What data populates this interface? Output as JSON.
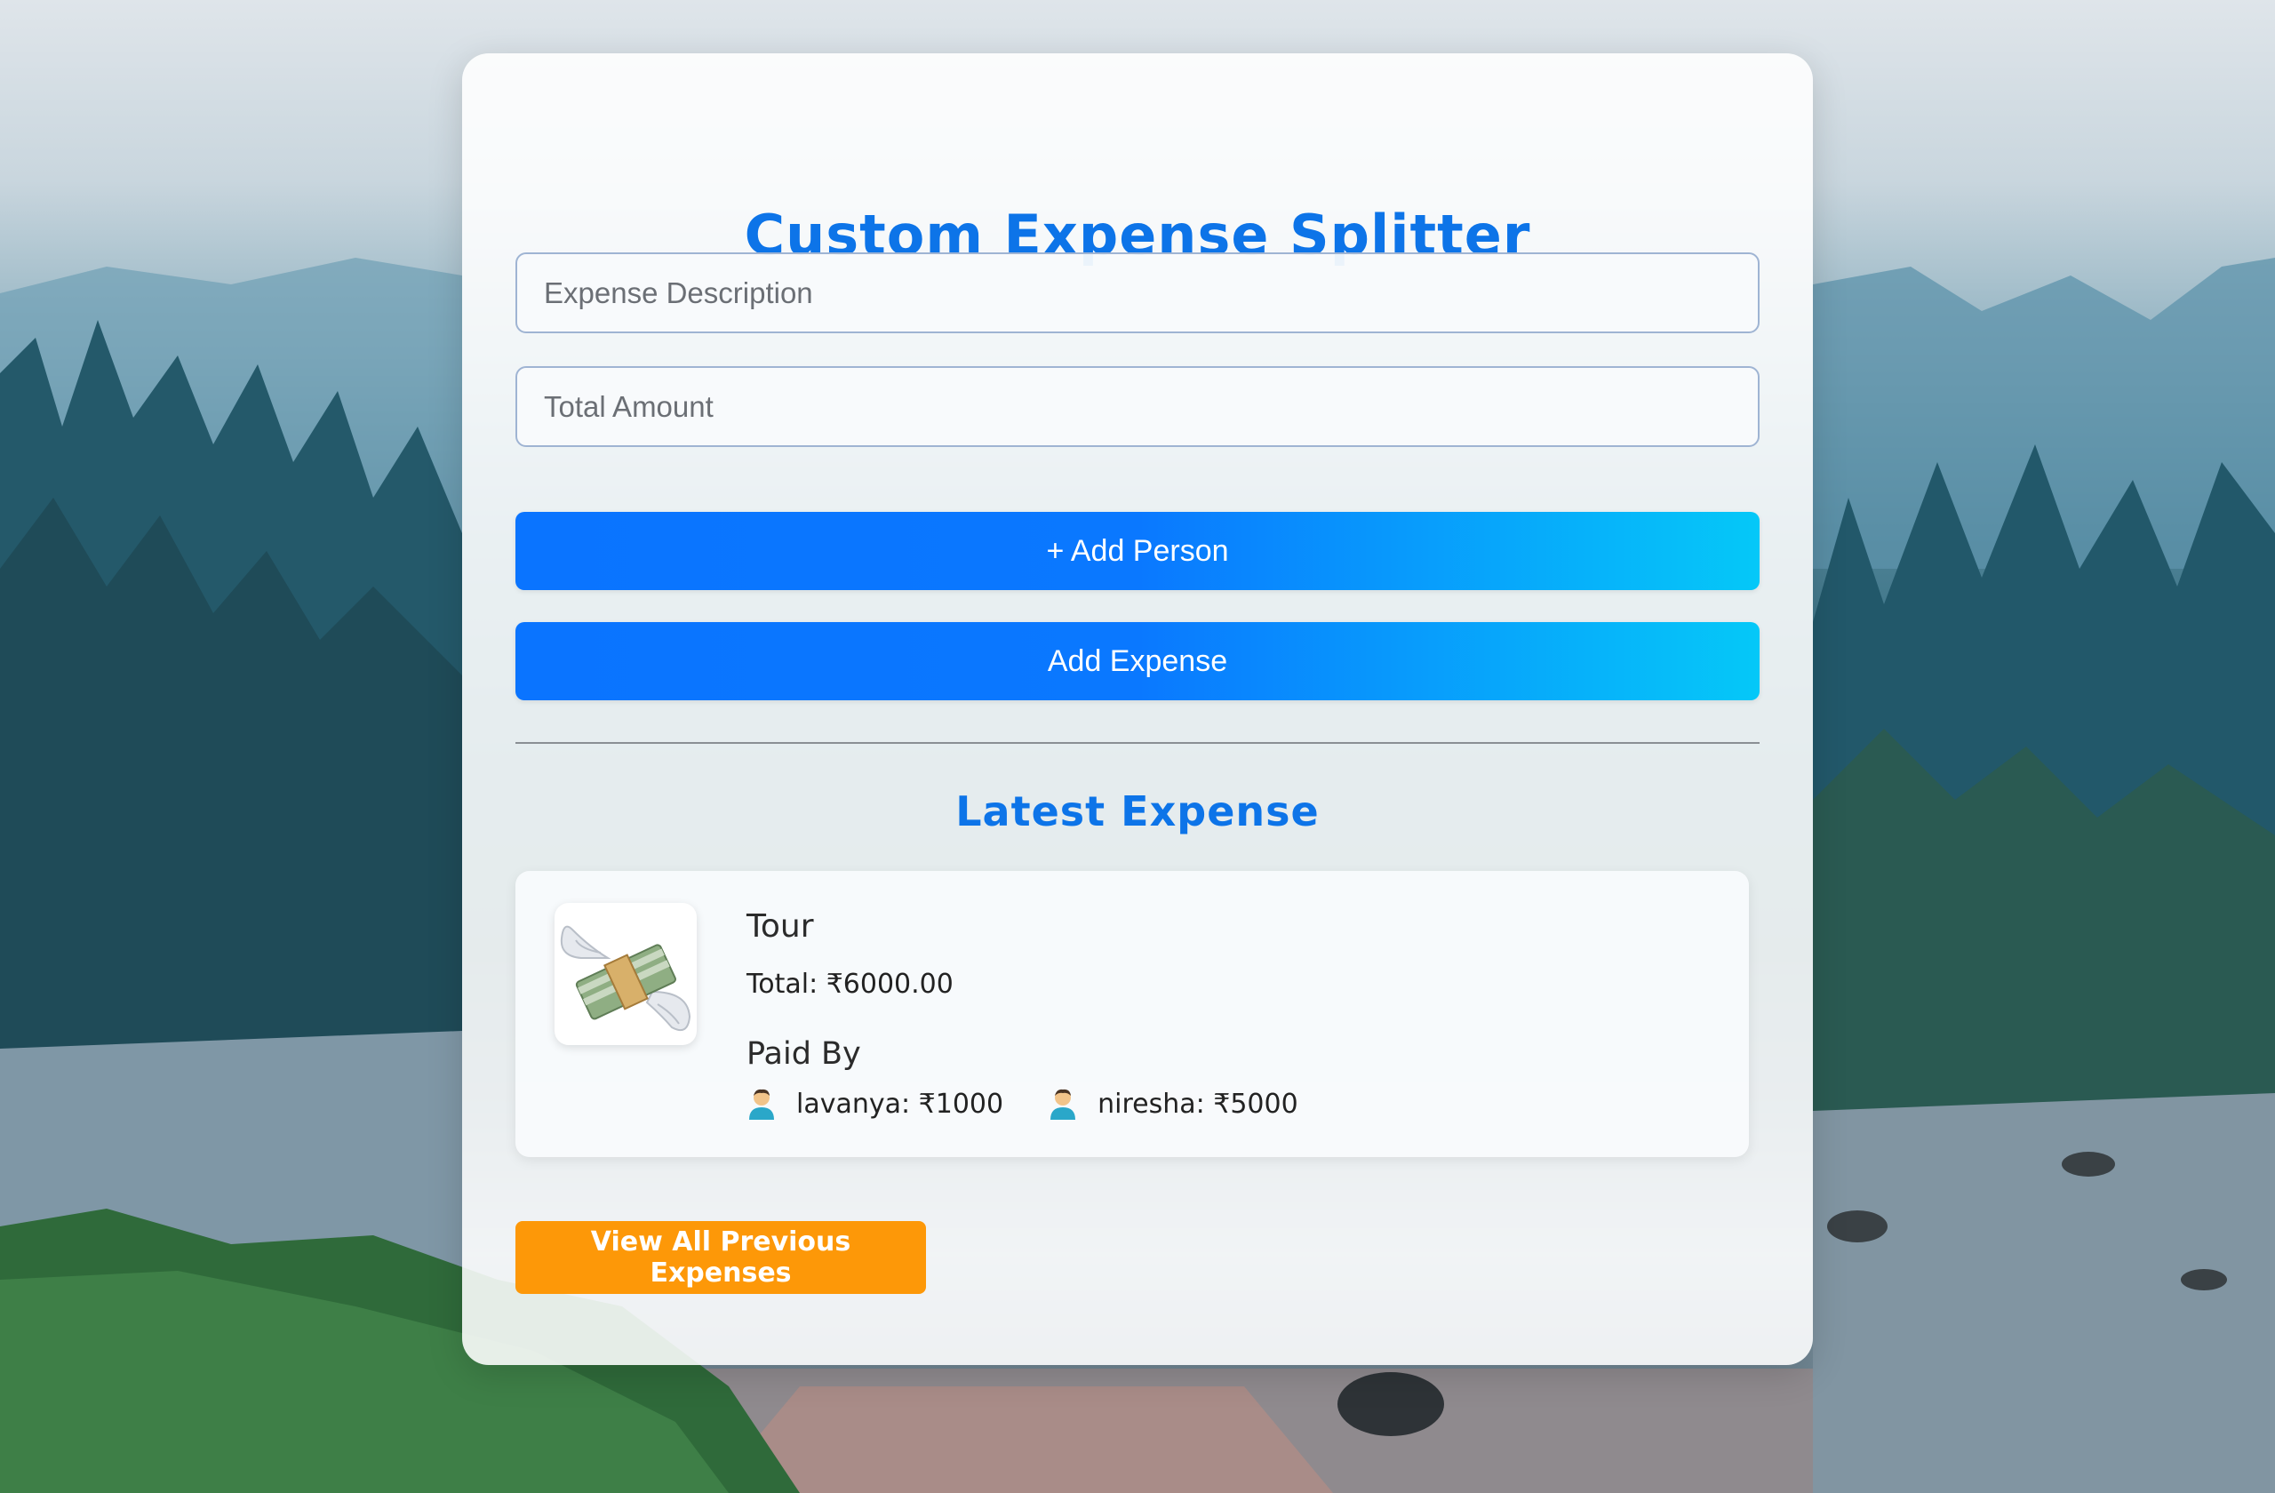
{
  "app": {
    "title": "Custom Expense Splitter"
  },
  "form": {
    "description_placeholder": "Expense Description",
    "description_value": "",
    "amount_placeholder": "Total Amount",
    "amount_value": "",
    "add_person_label": "+ Add Person",
    "add_expense_label": "Add Expense"
  },
  "latest": {
    "heading": "Latest Expense",
    "thumbnail_icon": "flying-money-icon",
    "name": "Tour",
    "total_text": "Total: ₹6000.00",
    "paid_by_label": "Paid By",
    "payers": [
      {
        "icon": "person-icon",
        "text": "lavanya: ₹1000"
      },
      {
        "icon": "person-icon",
        "text": "niresha: ₹5000"
      }
    ]
  },
  "actions": {
    "view_all_label": "View All Previous Expenses"
  },
  "colors": {
    "accent": "#0d74e8",
    "button_gradient_start": "#0a74ff",
    "button_gradient_end": "#05c8f8",
    "view_all": "#fd9808"
  }
}
